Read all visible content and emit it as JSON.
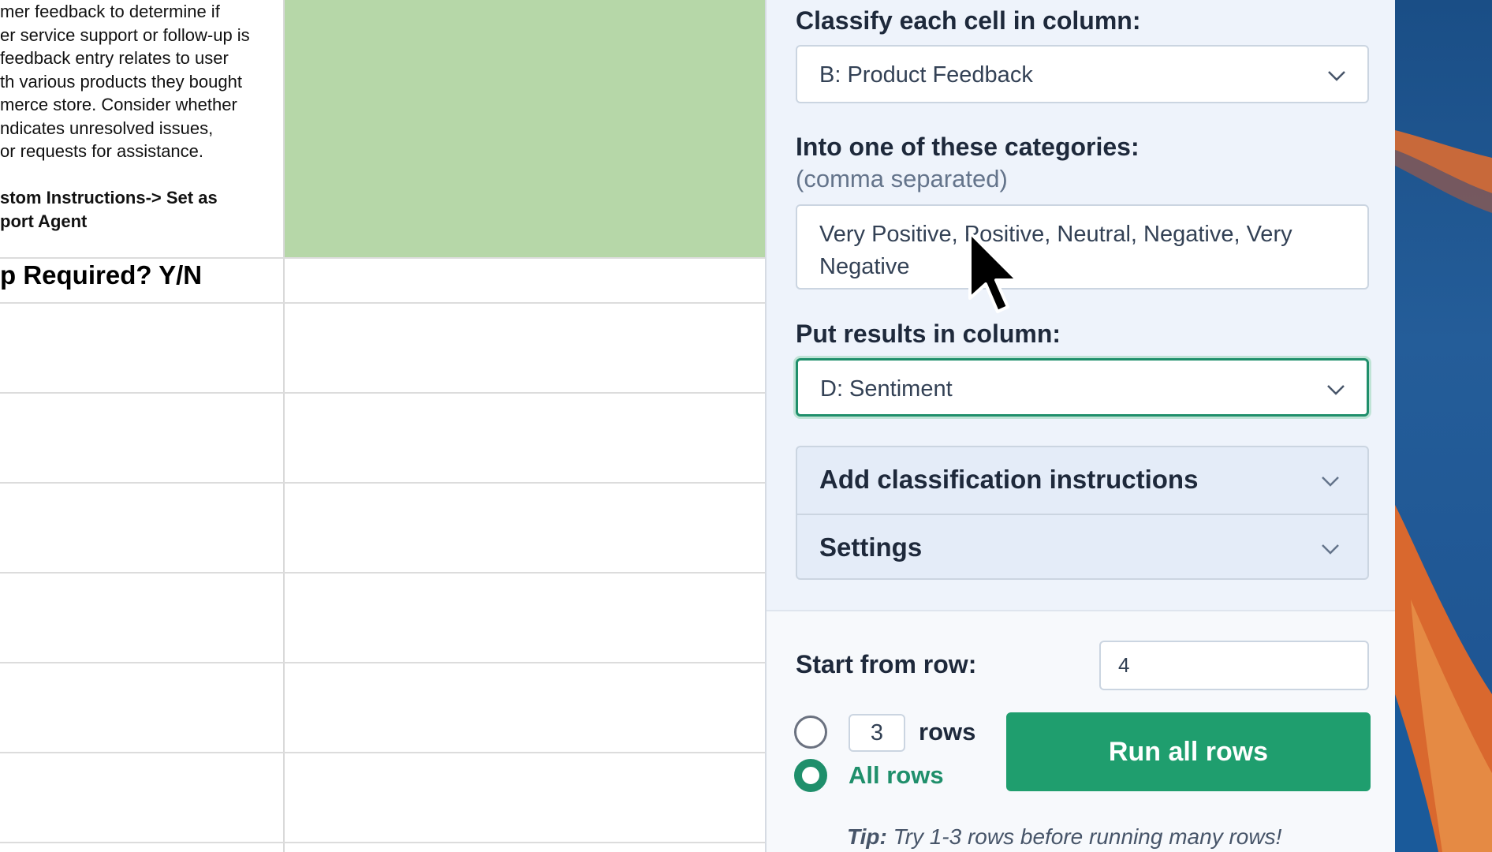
{
  "sheet": {
    "instructions_lines": [
      "mer feedback to determine if",
      "er service support or follow-up is",
      "feedback entry relates to user",
      "th various products they bought",
      "merce store. Consider whether",
      "ndicates unresolved issues,",
      " or requests for assistance.",
      "",
      "stom Instructions-> Set as",
      "port Agent"
    ],
    "header_text": "p Required? Y/N"
  },
  "panel": {
    "classify_label": "Classify each cell in column:",
    "classify_value": "B: Product Feedback",
    "categories_label": "Into one of these categories:",
    "categories_sublabel": "(comma separated)",
    "categories_value": "Very Positive, Positive, Neutral, Negative, Very Negative",
    "results_label": "Put results in column:",
    "results_value": "D: Sentiment",
    "accordion": {
      "instructions": "Add classification instructions",
      "settings": "Settings"
    },
    "start_label": "Start from row:",
    "start_value": "4",
    "rows_count": "3",
    "rows_label": "rows",
    "all_rows_label": "All rows",
    "run_button": "Run all rows",
    "tip_prefix": "Tip:",
    "tip_text": " Try 1-3 rows before running many rows!"
  },
  "colors": {
    "accent": "#1f9e6e",
    "green_cell": "#b6d7a8",
    "panel_bg": "#eef3fb"
  }
}
